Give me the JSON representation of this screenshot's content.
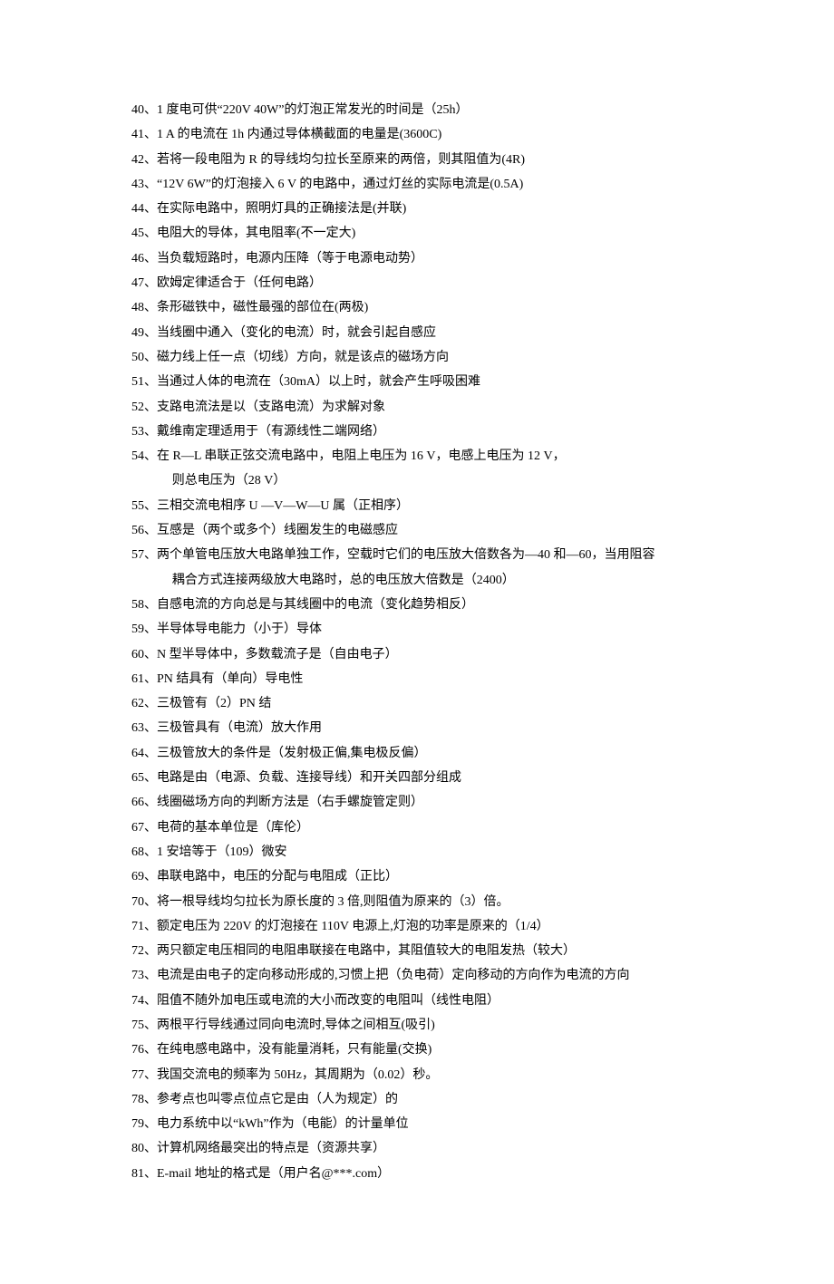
{
  "items": [
    {
      "n": "40",
      "t": "1 度电可供“220V  40W”的灯泡正常发光的时间是（25h）"
    },
    {
      "n": "41",
      "t": "1 A 的电流在 1h 内通过导体横截面的电量是(3600C)"
    },
    {
      "n": "42",
      "t": "若将一段电阻为 R 的导线均匀拉长至原来的两倍，则其阻值为(4R)"
    },
    {
      "n": "43",
      "t": "“12V  6W”的灯泡接入 6 V 的电路中，通过灯丝的实际电流是(0.5A)"
    },
    {
      "n": "44",
      "t": "在实际电路中，照明灯具的正确接法是(并联)"
    },
    {
      "n": "45",
      "t": "电阻大的导体，其电阻率(不一定大)"
    },
    {
      "n": "46",
      "t": "当负载短路时，电源内压降（等于电源电动势）"
    },
    {
      "n": "47",
      "t": "欧姆定律适合于（任何电路）"
    },
    {
      "n": "48",
      "t": "条形磁铁中，磁性最强的部位在(两极)"
    },
    {
      "n": "49",
      "t": "当线圈中通入（变化的电流）时，就会引起自感应"
    },
    {
      "n": "50",
      "t": "磁力线上任一点（切线）方向，就是该点的磁场方向"
    },
    {
      "n": "51",
      "t": "当通过人体的电流在（30mA）以上时，就会产生呼吸困难"
    },
    {
      "n": "52",
      "t": "支路电流法是以（支路电流）为求解对象"
    },
    {
      "n": "53",
      "t": "戴维南定理适用于（有源线性二端网络）"
    },
    {
      "n": "54",
      "t": "在 R—L 串联正弦交流电路中，电阻上电压为 16 V，电感上电压为 12 V，",
      "t2": "则总电压为（28 V）"
    },
    {
      "n": "55",
      "t": "三相交流电相序 U —V—W—U 属（正相序）"
    },
    {
      "n": "56",
      "t": "互感是（两个或多个）线圈发生的电磁感应"
    },
    {
      "n": "57",
      "t": "两个单管电压放大电路单独工作，空载时它们的电压放大倍数各为—40 和—60，当用阻容",
      "t2": "耦合方式连接两级放大电路时，总的电压放大倍数是（2400）"
    },
    {
      "n": "58",
      "t": "自感电流的方向总是与其线圈中的电流（变化趋势相反）"
    },
    {
      "n": "59",
      "t": "半导体导电能力（小于）导体"
    },
    {
      "n": "60",
      "t": "N 型半导体中，多数载流子是（自由电子）"
    },
    {
      "n": "61",
      "t": "PN 结具有（单向）导电性"
    },
    {
      "n": "62",
      "t": "三极管有（2）PN 结"
    },
    {
      "n": "63",
      "t": "三极管具有（电流）放大作用"
    },
    {
      "n": "64",
      "t": "三极管放大的条件是（发射极正偏,集电极反偏）"
    },
    {
      "n": "65",
      "t": "电路是由（电源、负载、连接导线）和开关四部分组成"
    },
    {
      "n": "66",
      "t": "线圈磁场方向的判断方法是（右手螺旋管定则）"
    },
    {
      "n": "67",
      "t": "电荷的基本单位是（库伦）"
    },
    {
      "n": "68",
      "t": "1 安培等于（109）微安"
    },
    {
      "n": "69",
      "t": "串联电路中，电压的分配与电阻成（正比）"
    },
    {
      "n": "70",
      "t": "将一根导线均匀拉长为原长度的 3 倍,则阻值为原来的（3）倍。"
    },
    {
      "n": "71",
      "t": "额定电压为 220V 的灯泡接在 110V 电源上,灯泡的功率是原来的（1/4）"
    },
    {
      "n": "72",
      "t": "两只额定电压相同的电阻串联接在电路中，其阻值较大的电阻发热（较大）"
    },
    {
      "n": "73",
      "t": "电流是由电子的定向移动形成的,习惯上把（负电荷）定向移动的方向作为电流的方向"
    },
    {
      "n": "74",
      "t": "阻值不随外加电压或电流的大小而改变的电阻叫（线性电阻）"
    },
    {
      "n": "75",
      "t": "两根平行导线通过同向电流时,导体之间相互(吸引)"
    },
    {
      "n": "76",
      "t": "在纯电感电路中，没有能量消耗，只有能量(交换)"
    },
    {
      "n": "77",
      "t": "我国交流电的频率为 50Hz，其周期为（0.02）秒。"
    },
    {
      "n": "78",
      "t": "参考点也叫零点位点它是由（人为规定）的"
    },
    {
      "n": "79",
      "t": "电力系统中以“kWh”作为（电能）的计量单位"
    },
    {
      "n": "80",
      "t": "计算机网络最突出的特点是（资源共享）"
    },
    {
      "n": "81",
      "t": "E-mail 地址的格式是（用户名@***.com）"
    }
  ]
}
